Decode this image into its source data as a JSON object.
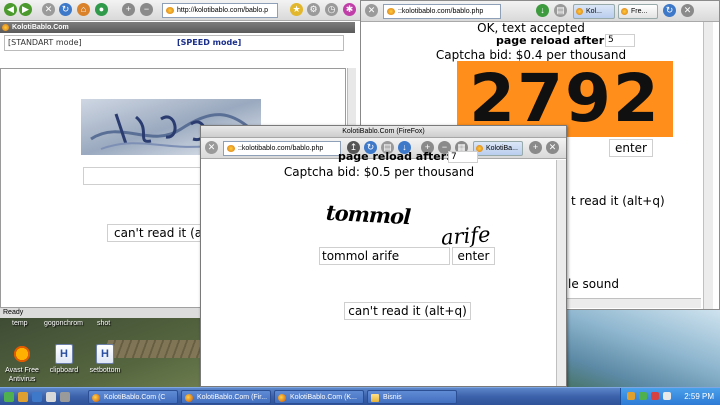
{
  "desktop": {
    "top_labels": [
      "temp",
      "gogonchrom",
      "shot"
    ],
    "icons": [
      {
        "label": "Avast Free Antivirus",
        "icon": "avast-icon"
      },
      {
        "label": "clipboard",
        "icon": "file-h-icon"
      },
      {
        "label": "setbottom",
        "icon": "file-h-icon"
      }
    ],
    "file_glyph": "H"
  },
  "taskbar": {
    "items": [
      "KolotiBablo.Com (C",
      "KolotiBablo.Com (Fir...",
      "KolotiBablo.Com (K...",
      "Bisnis"
    ],
    "clock": "2:59 PM"
  },
  "window_left": {
    "url": "http://kolotibablo.com/bablo.p",
    "titlebar": "KolotiBablo.Com",
    "mode_standart": "[STANDART mode]",
    "mode_speed": "[SPEED mode]",
    "cant_read": "can't read it  (a",
    "status": "Ready"
  },
  "window_right": {
    "url": "::kolotibablo.com/bablo.php",
    "tabs": [
      "Kol...",
      "Fre..."
    ],
    "accepted": "OK, text accepted",
    "reload_label": "page reload after:",
    "reload_value": "5",
    "bid": "Captcha bid: $0.4 per thousand",
    "captcha_text": "2792",
    "enter": "enter",
    "cant_read": "t read it  (alt+q)",
    "sound": "le sound",
    "colors": {
      "captcha_bg": "#ff8e1a"
    }
  },
  "window_front": {
    "caption": "KolotiBablo.Com (FireFox)",
    "url": "::kolotibablo.com/bablo.php",
    "tab": "KolotiBa...",
    "reload_label": "page reload after:",
    "reload_value": "7",
    "bid": "Captcha bid: $0.5 per thousand",
    "captcha_word1": "tommol",
    "captcha_word2": "arife",
    "answer_value": "tommol arife",
    "enter": "enter",
    "cant_read": "can't read it  (alt+q)"
  }
}
